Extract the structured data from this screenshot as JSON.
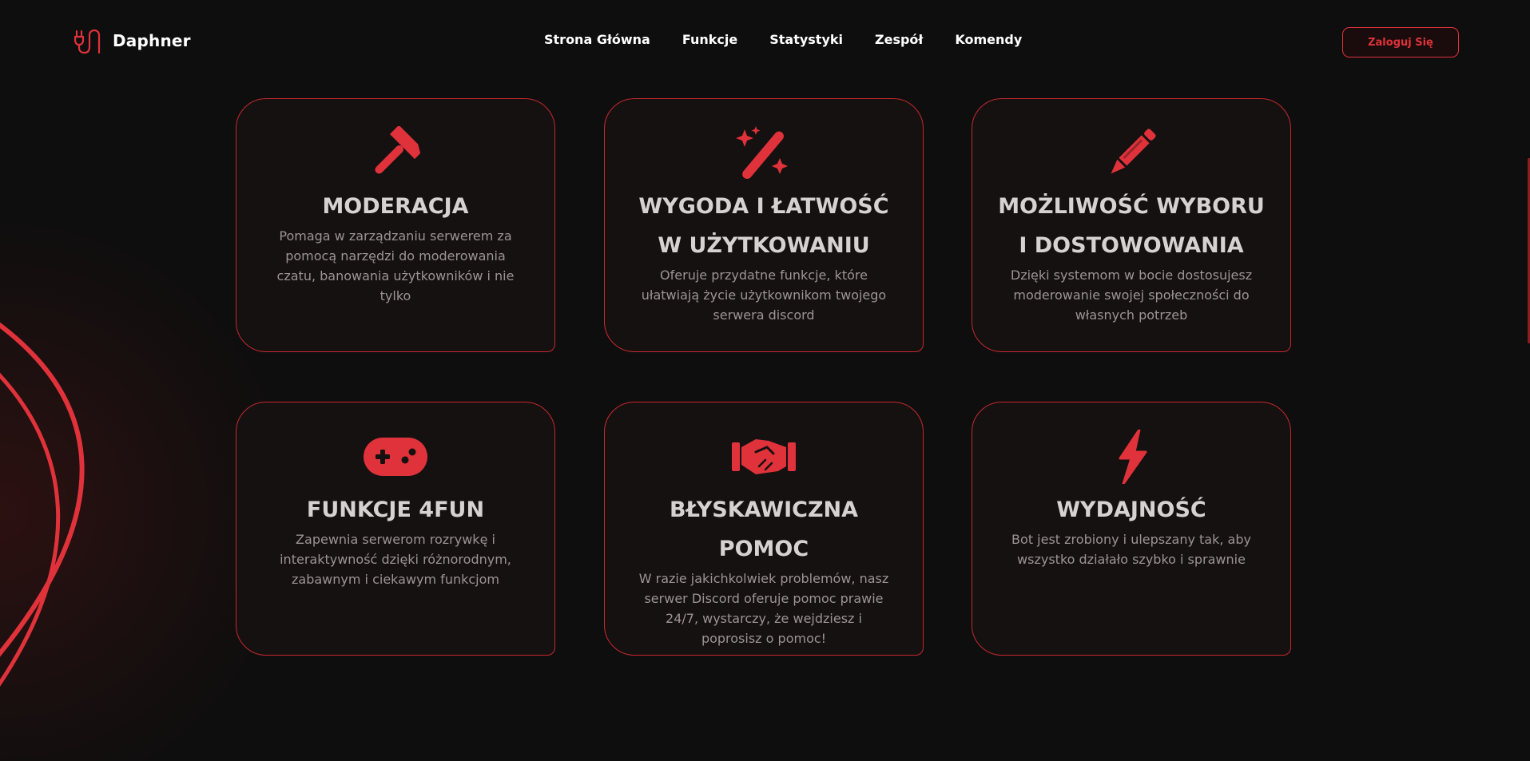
{
  "header": {
    "brand_name": "Daphner",
    "nav": [
      {
        "label": "Strona Główna"
      },
      {
        "label": "Funkcje"
      },
      {
        "label": "Statystyki"
      },
      {
        "label": "Zespół"
      },
      {
        "label": "Komendy"
      }
    ],
    "login_label": "Zaloguj Się"
  },
  "colors": {
    "accent": "#e0323a",
    "background": "#0f0e0e",
    "card_background": "#151111",
    "card_border": "#c5282e",
    "title_text": "#d7d2d2",
    "body_text": "#9c9494"
  },
  "features": [
    {
      "icon": "hammer-icon",
      "title": "MODERACJA",
      "description": "Pomaga w zarządzaniu serwerem za pomocą narzędzi do moderowania czatu, banowania użytkowników i nie tylko"
    },
    {
      "icon": "magic-wand-icon",
      "title": "WYGODA I ŁATWOŚĆ\nW UŻYTKOWANIU",
      "description": "Oferuje przydatne funkcje, które ułatwiają życie użytkownikom twojego serwera discord"
    },
    {
      "icon": "pencil-icon",
      "title": "MOŻLIWOŚĆ WYBORU\nI DOSTOWOWANIA",
      "description": "Dzięki systemom w bocie dostosujesz moderowanie swojej społeczności do własnych potrzeb"
    },
    {
      "icon": "gamepad-icon",
      "title": "FUNKCJE 4FUN",
      "description": "Zapewnia serwerom rozrywkę i interaktywność dzięki różnorodnym, zabawnym i ciekawym funkcjom"
    },
    {
      "icon": "handshake-icon",
      "title": "BŁYSKAWICZNA\nPOMOC",
      "description": "W razie jakichkolwiek problemów, nasz serwer Discord oferuje pomoc prawie 24/7, wystarczy, że wejdziesz i poprosisz o pomoc!"
    },
    {
      "icon": "lightning-bolt-icon",
      "title": "WYDAJNOŚĆ",
      "description": "Bot jest zrobiony i ulepszany tak, aby wszystko działało szybko i sprawnie"
    }
  ]
}
